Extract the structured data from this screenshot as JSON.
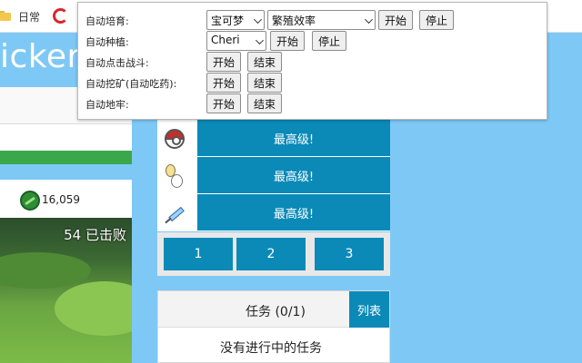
{
  "bookmarks": {
    "folder_label": "日常"
  },
  "game": {
    "title_fragment": "icker",
    "currency_value": "16,059",
    "defeated_text": "54 已击败"
  },
  "upgrades": [
    {
      "icon": "pokeball-icon",
      "label": "最高级!"
    },
    {
      "icon": "egg-icon",
      "label": "最高级!"
    },
    {
      "icon": "syringe-icon",
      "label": "最高级!"
    }
  ],
  "pager": [
    "1",
    "2",
    "3"
  ],
  "tasks": {
    "title": "任务 (0/1)",
    "list_button": "列表",
    "empty_text": "没有进行中的任务"
  },
  "automation": {
    "breeding": {
      "label": "自动培育:",
      "target_select": "宝可梦",
      "mode_select": "繁殖效率",
      "start": "开始",
      "stop": "停止"
    },
    "farming": {
      "label": "自动种植:",
      "berry_select": "Cheri",
      "start": "开始",
      "stop": "停止"
    },
    "battle": {
      "label": "自动点击战斗:",
      "start": "开始",
      "end": "结束"
    },
    "mining": {
      "label": "自动挖矿(自动吃药):",
      "start": "开始",
      "end": "结束"
    },
    "dungeon": {
      "label": "自动地牢:",
      "start": "开始",
      "end": "结束"
    }
  },
  "colors": {
    "accent_blue": "#0b8ab8",
    "background_sky": "#7ec8f6",
    "progress_green": "#3aa84a"
  }
}
